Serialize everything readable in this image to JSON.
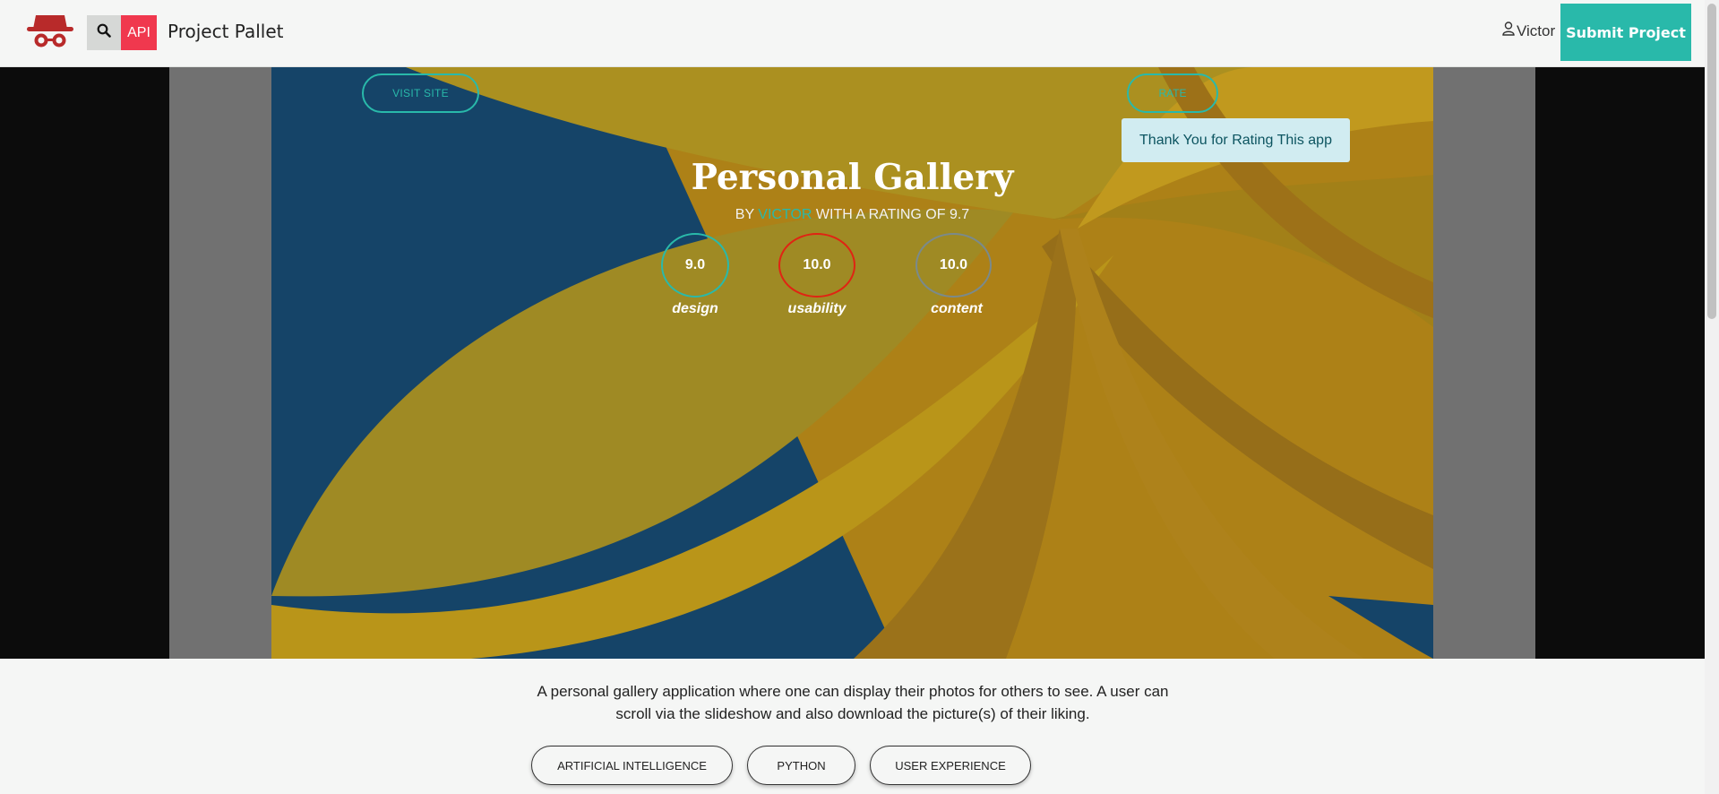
{
  "navbar": {
    "brand": "Project Pallet",
    "api_label": "API",
    "user_name": "Victor",
    "submit_label": "Submit Project",
    "icons": [
      "spy-hat-logo-icon",
      "search-icon",
      "user-icon"
    ]
  },
  "project": {
    "title": "Personal Gallery",
    "by_prefix": "BY",
    "author": "VICTOR",
    "rating_prefix": "WITH A RATING OF",
    "rating": "9.7",
    "visit_label": "VISIT SITE",
    "rate_label": "RATE",
    "toast": "Thank You for Rating This app",
    "scores": [
      {
        "value": "9.0",
        "label": "design"
      },
      {
        "value": "10.0",
        "label": "usability"
      },
      {
        "value": "10.0",
        "label": "content"
      }
    ],
    "description": "A personal gallery application where one can display their photos for others to see. A user can scroll via the slideshow and also download the picture(s) of their liking.",
    "tags": [
      "ARTIFICIAL INTELLIGENCE",
      "PYTHON",
      "USER EXPERIENCE"
    ]
  },
  "colors": {
    "accent": "#29b9aa",
    "api": "#f0384e",
    "usability_ring": "#e02413",
    "content_ring": "#7a8a8c",
    "art_blue": "#05406f",
    "art_yellow": "#d6a80a"
  }
}
